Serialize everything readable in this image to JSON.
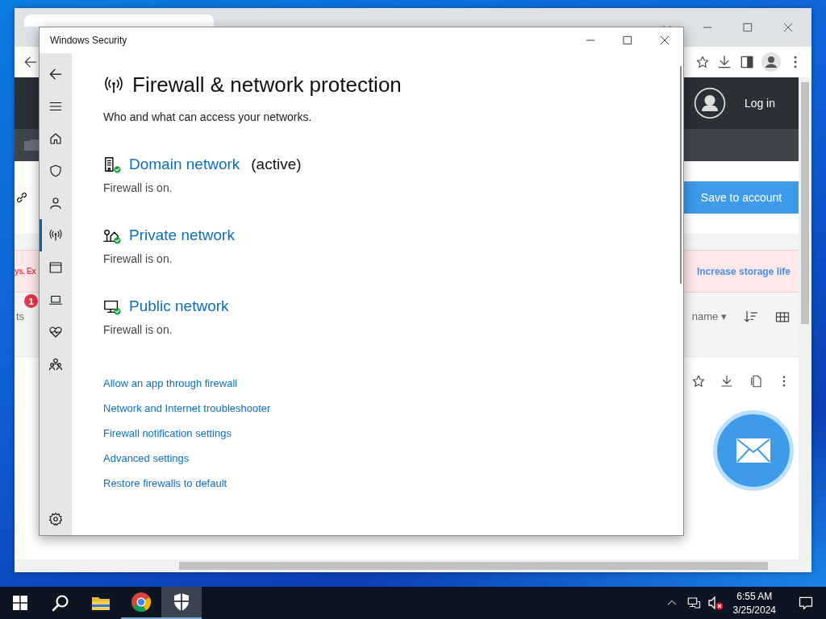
{
  "browser": {
    "header": {
      "login": "Log in"
    },
    "save_button": "Save to account",
    "banner": {
      "left_text": "ys. Ex",
      "link": "Increase storage life"
    },
    "toolbar": {
      "left_text": "ts",
      "badge": "1",
      "sort_label": "name",
      "sort_caret": "▾"
    }
  },
  "security_window": {
    "title": "Windows Security",
    "nav": [
      {
        "kind": "home",
        "selected": false
      },
      {
        "kind": "shield",
        "selected": false
      },
      {
        "kind": "person",
        "selected": false
      },
      {
        "kind": "antenna",
        "selected": true
      },
      {
        "kind": "browser",
        "selected": false
      },
      {
        "kind": "laptop",
        "selected": false
      },
      {
        "kind": "heart",
        "selected": false
      },
      {
        "kind": "family",
        "selected": false
      }
    ],
    "heading": "Firewall & network protection",
    "subtitle": "Who and what can access your networks.",
    "networks": [
      {
        "kind": "domain",
        "name": "Domain network",
        "status": "(active)",
        "state": "Firewall is on."
      },
      {
        "kind": "private",
        "name": "Private network",
        "state": "Firewall is on."
      },
      {
        "kind": "public",
        "name": "Public network",
        "state": "Firewall is on."
      }
    ],
    "links": [
      "Allow an app through firewall",
      "Network and Internet troubleshooter",
      "Firewall notification settings",
      "Advanced settings",
      "Restore firewalls to default"
    ]
  },
  "taskbar": {
    "apps": [
      {
        "kind": "search",
        "running": false,
        "selected": false
      },
      {
        "kind": "explorer",
        "running": false,
        "selected": false
      },
      {
        "kind": "chrome",
        "running": true,
        "selected": false
      },
      {
        "kind": "security",
        "running": true,
        "selected": true
      }
    ],
    "time": "6:55 AM",
    "date": "3/25/2024"
  }
}
